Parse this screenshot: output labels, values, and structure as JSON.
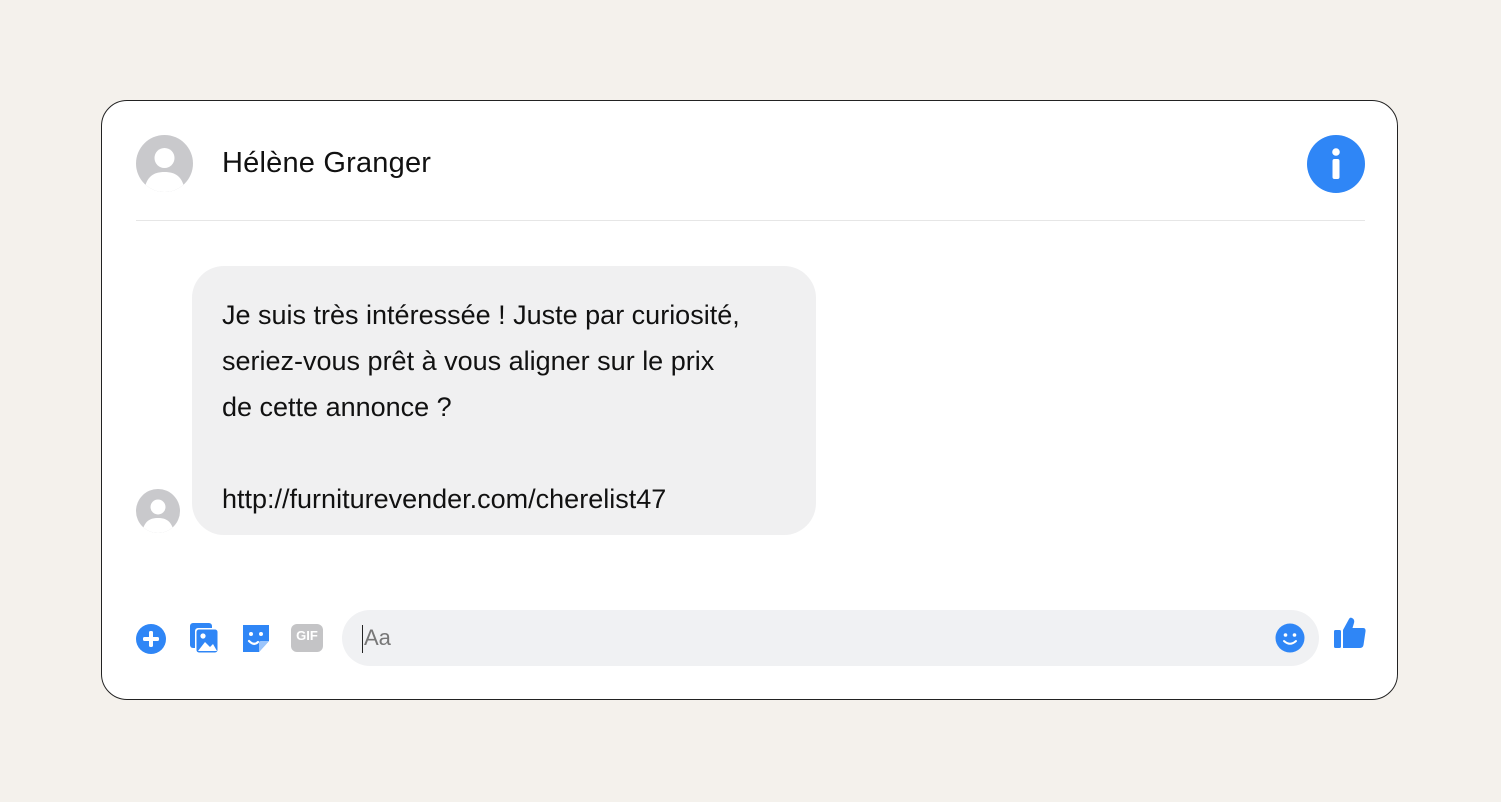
{
  "contact": {
    "name": "Hélène Granger"
  },
  "conversation": {
    "messages": [
      {
        "lines": [
          "Je suis très intéressée ! Juste par curiosité,",
          "seriez-vous prêt à vous aligner sur le prix",
          "de cette annonce ?"
        ],
        "link": "http://furniturevender.com/cherelist47"
      }
    ]
  },
  "composer": {
    "placeholder": "Aa",
    "tools": [
      "plus-icon",
      "photo-icon",
      "sticker-icon",
      "gif-icon"
    ],
    "gif_label": "GIF"
  },
  "icons": {
    "info": "info-icon",
    "emoji": "emoji-icon",
    "like": "thumbs-up-icon",
    "avatar": "user-silhouette-icon"
  },
  "colors": {
    "accent": "#2f86f6",
    "bubble": "#f0f0f1",
    "background": "#f4f1ec",
    "gif": "#c4c4c6"
  }
}
